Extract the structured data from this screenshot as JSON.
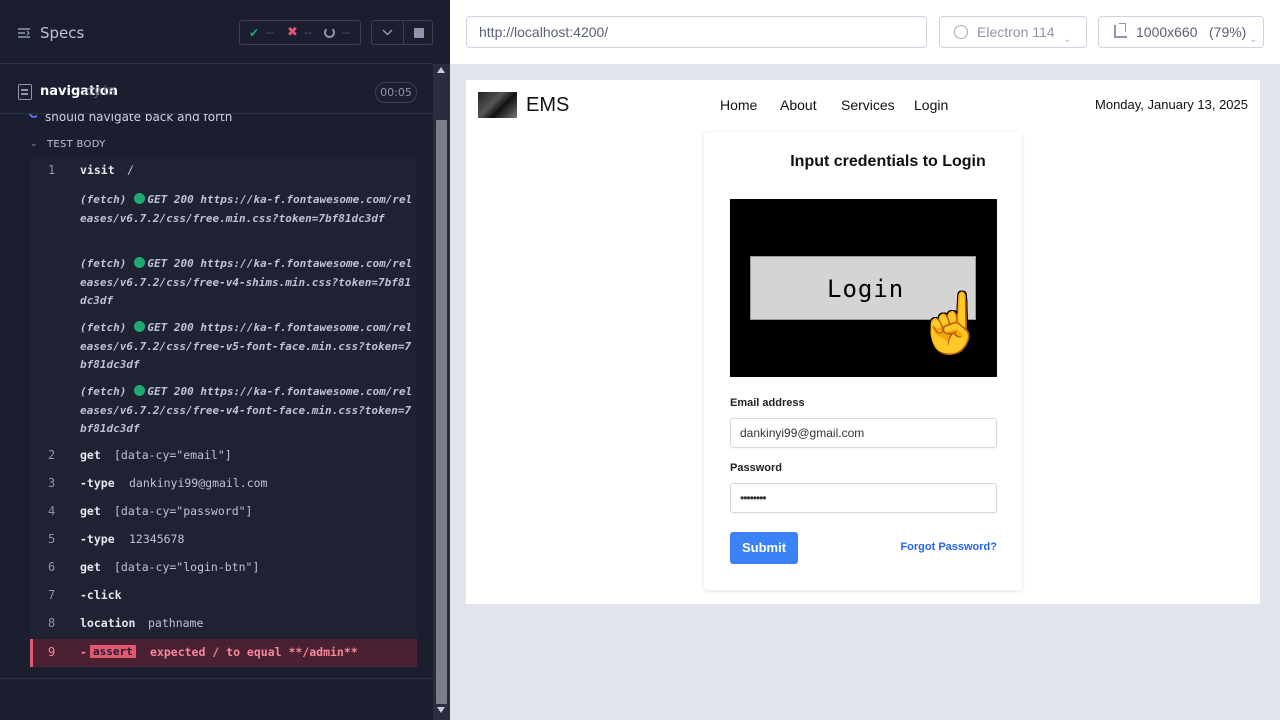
{
  "specs_header": {
    "title": "Specs",
    "passed": "--",
    "failed": "--",
    "pending": "--"
  },
  "spec_file": {
    "name": "navigation",
    "ext": ".cy.ts",
    "duration": "00:05"
  },
  "test": {
    "title": "should navigate back and forth",
    "body_label": "TEST BODY"
  },
  "commands": [
    {
      "num": "1",
      "name": "visit",
      "arg": "/"
    },
    {
      "num": "2",
      "name": "get",
      "arg": "[data-cy=\"email\"]"
    },
    {
      "num": "3",
      "name": "-type",
      "arg": "dankinyi99@gmail.com"
    },
    {
      "num": "4",
      "name": "get",
      "arg": "[data-cy=\"password\"]"
    },
    {
      "num": "5",
      "name": "-type",
      "arg": "12345678"
    },
    {
      "num": "6",
      "name": "get",
      "arg": "[data-cy=\"login-btn\"]"
    },
    {
      "num": "7",
      "name": "-click",
      "arg": ""
    },
    {
      "num": "8",
      "name": "location",
      "arg": "pathname"
    },
    {
      "num": "9",
      "name": "-",
      "tag": "assert",
      "arg": "expected / to equal **/admin**"
    }
  ],
  "fetches": [
    {
      "label": "(fetch)",
      "method": "GET 200",
      "url": "https://ka-f.fontawesome.com/releases/v6.7.2/css/free.min.css?token=7bf81dc3df"
    },
    {
      "label": "(fetch)",
      "method": "GET 200",
      "url": "https://ka-f.fontawesome.com/releases/v6.7.2/css/free-v4-shims.min.css?token=7bf81dc3df"
    },
    {
      "label": "(fetch)",
      "method": "GET 200",
      "url": "https://ka-f.fontawesome.com/releases/v6.7.2/css/free-v5-font-face.min.css?token=7bf81dc3df"
    },
    {
      "label": "(fetch)",
      "method": "GET 200",
      "url": "https://ka-f.fontawesome.com/releases/v6.7.2/css/free-v4-font-face.min.css?token=7bf81dc3df"
    }
  ],
  "browser_bar": {
    "url": "http://localhost:4200/",
    "browser": "Electron 114",
    "viewport_size": "1000x660",
    "viewport_scale": "(79%)"
  },
  "app": {
    "brand": "EMS",
    "nav": [
      "Home",
      "About",
      "Services",
      "Login"
    ],
    "date": "Monday, January 13, 2025",
    "card_title": "Input credentials to Login",
    "hero_text": "Login",
    "email_label": "Email address",
    "email_value": "dankinyi99@gmail.com",
    "password_label": "Password",
    "password_value": "••••••••",
    "submit": "Submit",
    "forgot": "Forgot Password?"
  },
  "icons": {
    "specs": "list-icon",
    "passed": "check-icon",
    "failed": "x-icon",
    "pending": "spinner-icon",
    "browser": "electron-icon",
    "viewport": "ruler-icon"
  },
  "colors": {
    "pass": "#1fa971",
    "fail": "#e45770",
    "accent": "#3b82f6"
  }
}
